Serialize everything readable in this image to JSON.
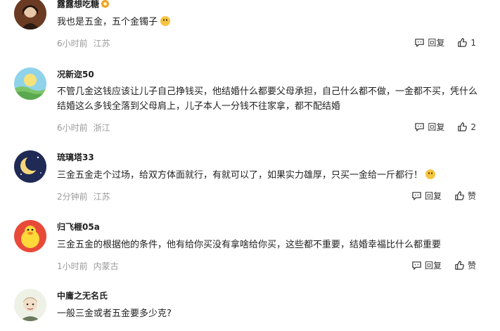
{
  "comments": [
    {
      "username": "露露想吃糖",
      "text": "我也是五金，五个金镯子",
      "time": "6小时前",
      "location": "江苏",
      "reply_label": "回复",
      "like_label": "1"
    },
    {
      "username": "况新迩50",
      "text": "不管几金这钱应该让儿子自己挣钱买，他结婚什么都要父母承担，自己什么都不做，一金都不买，凭什么结婚这么多钱全落到父母肩上，儿子本人一分钱不往家拿，都不配结婚",
      "time": "6小时前",
      "location": "浙江",
      "reply_label": "回复",
      "like_label": "2"
    },
    {
      "username": "琉璃塔33",
      "text": "三金五金走个过场，给双方体面就行，有就可以了，如果实力雄厚，只买一金给一斤都行！",
      "time": "2分钟前",
      "location": "江苏",
      "reply_label": "回复",
      "like_label": "赞"
    },
    {
      "username": "归飞榧05a",
      "text": "三金五金的根据他的条件，他有给你买没有拿啥给你买，这些都不重要，结婚幸福比什么都重要",
      "time": "1小时前",
      "location": "内蒙古",
      "reply_label": "回复",
      "like_label": "赞"
    },
    {
      "username": "中庸之无名氏",
      "text": "一般三金或者五金要多少克?",
      "time": "",
      "location": "",
      "reply_label": "",
      "like_label": ""
    }
  ]
}
